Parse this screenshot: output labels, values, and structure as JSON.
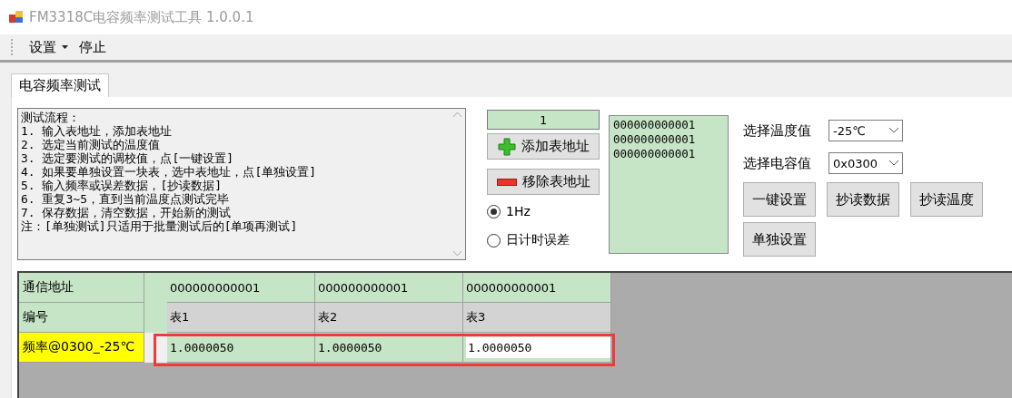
{
  "window": {
    "title": "FM3318C电容频率测试工具 1.0.0.1"
  },
  "menu": [
    {
      "label": "设置",
      "dropdown": true
    },
    {
      "label": "停止",
      "dropdown": false
    }
  ],
  "tabs": [
    {
      "label": "电容频率测试",
      "selected": true
    }
  ],
  "instructions": [
    "测试流程：",
    "1. 输入表地址，添加表地址",
    "2. 选定当前测试的温度值",
    "3. 选定要测试的调校值，点[一键设置]",
    "4. 如果要单独设置一块表，选中表地址，点[单独设置]",
    "5. 输入频率或误差数据，[抄读数据]",
    "6. 重复3~5，直到当前温度点测试完毕",
    "7. 保存数据，清空数据，开始新的测试",
    "注：[单独测试]只适用于批量测试后的[单项再测试]"
  ],
  "address_input": {
    "value": "1"
  },
  "add_button": {
    "label": "添加表地址"
  },
  "remove_button": {
    "label": "移除表地址"
  },
  "modes": [
    {
      "label": "1Hz",
      "selected": true
    },
    {
      "label": "日计时误差",
      "selected": false
    }
  ],
  "address_list": [
    "000000000001",
    "000000000001",
    "000000000001"
  ],
  "selectors": [
    {
      "label": "选择温度值",
      "value": "-25℃"
    },
    {
      "label": "选择电容值",
      "value": "0x0300"
    }
  ],
  "actions": [
    [
      "一键设置",
      "抄读数据",
      "抄读温度"
    ],
    [
      "单独设置"
    ]
  ],
  "grid": {
    "rows": [
      {
        "header": "通信地址",
        "kind": "address",
        "highlight": false,
        "cells": [
          {
            "value": "000000000001",
            "editing": false
          },
          {
            "value": "000000000001",
            "editing": false
          },
          {
            "value": "000000000001",
            "editing": false
          }
        ]
      },
      {
        "header": "编号",
        "kind": "number",
        "highlight": false,
        "cells": [
          {
            "value": "表1",
            "editing": false
          },
          {
            "value": "表2",
            "editing": false
          },
          {
            "value": "表3",
            "editing": false
          }
        ]
      },
      {
        "header": "频率@0300_-25℃",
        "kind": "frequency",
        "highlight": true,
        "cells": [
          {
            "value": "1.0000050",
            "editing": false
          },
          {
            "value": "1.0000050",
            "editing": false
          },
          {
            "value": "1.0000050",
            "editing": true
          }
        ]
      }
    ]
  }
}
